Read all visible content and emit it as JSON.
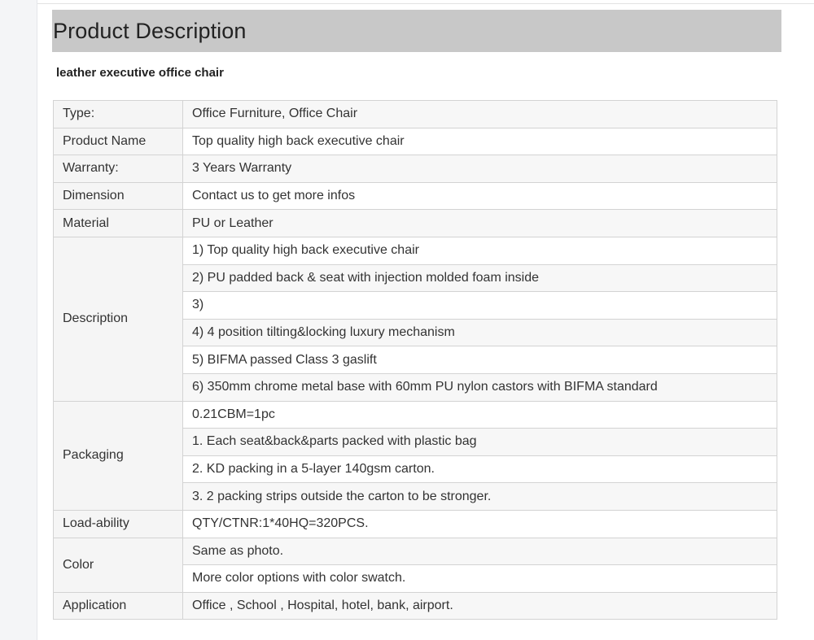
{
  "section_title": "Product Description",
  "product_subtitle": "leather executive office chair",
  "specs": [
    {
      "label": "Type:",
      "values": [
        "Office Furniture, Office Chair"
      ]
    },
    {
      "label": "Product Name",
      "values": [
        "Top quality high back executive chair"
      ]
    },
    {
      "label": "Warranty:",
      "values": [
        "3 Years Warranty"
      ]
    },
    {
      "label": "Dimension",
      "values": [
        "Contact us to get more infos"
      ]
    },
    {
      "label": "Material",
      "values": [
        "PU or Leather"
      ]
    },
    {
      "label": "Description",
      "values": [
        "1) Top quality high back executive chair",
        "2) PU padded back & seat with injection molded foam inside",
        "3)",
        "4) 4 position tilting&locking luxury mechanism",
        "5) BIFMA passed Class 3 gaslift",
        "6) 350mm chrome metal base with 60mm PU nylon castors with BIFMA standard"
      ]
    },
    {
      "label": "Packaging",
      "values": [
        "0.21CBM=1pc",
        "1. Each seat&back&parts packed with plastic bag",
        "2. KD packing in a 5-layer 140gsm carton.",
        "3. 2 packing strips outside the carton to be stronger."
      ]
    },
    {
      "label": "Load-ability",
      "values": [
        "QTY/CTNR:1*40HQ=320PCS."
      ]
    },
    {
      "label": "Color",
      "values": [
        "Same as photo.",
        "More color options with color swatch."
      ]
    },
    {
      "label": "Application",
      "values": [
        "Office , School , Hospital, hotel, bank, airport."
      ]
    }
  ]
}
